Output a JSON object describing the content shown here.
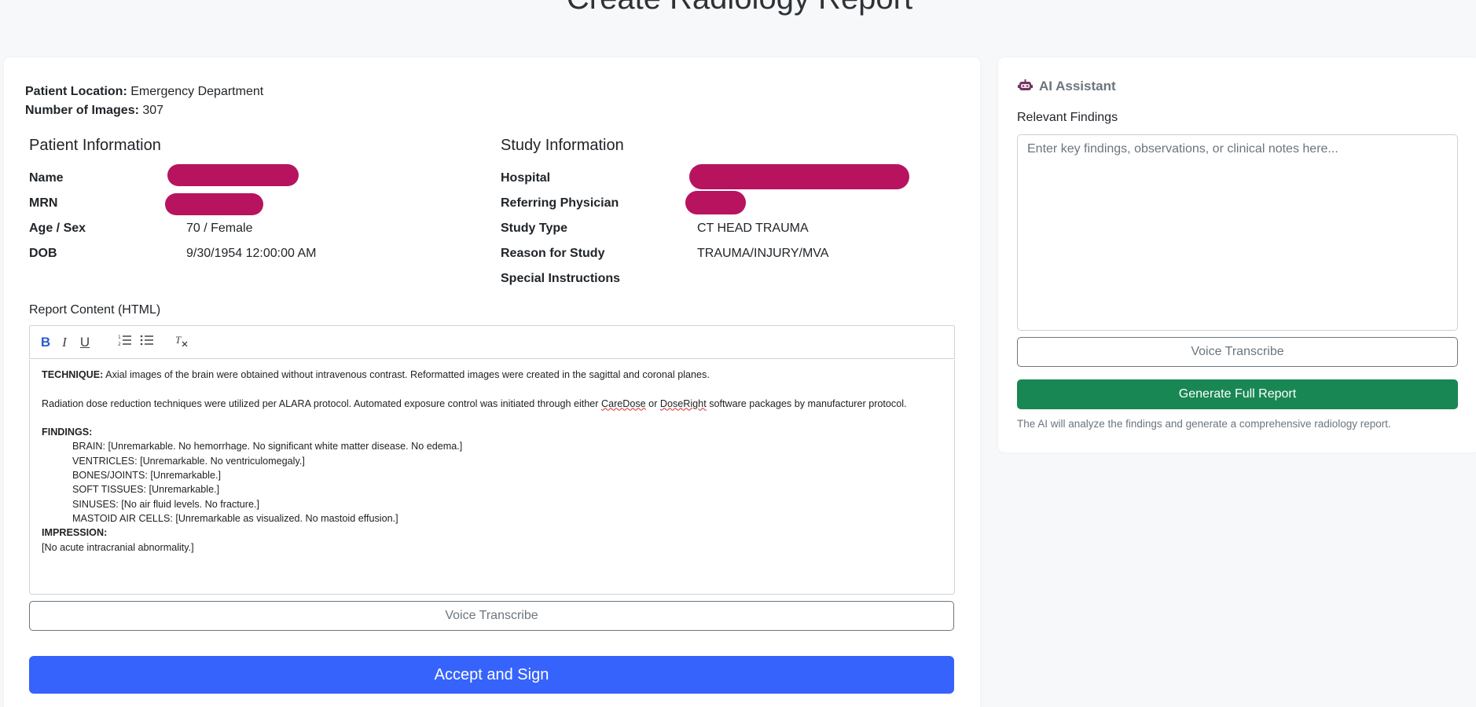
{
  "page": {
    "title": "Create Radiology Report"
  },
  "meta": {
    "location_label": "Patient Location:",
    "location_value": "Emergency Department",
    "images_label": "Number of Images:",
    "images_value": "307"
  },
  "patient": {
    "title": "Patient Information",
    "name_label": "Name",
    "mrn_label": "MRN",
    "age_sex_label": "Age / Sex",
    "age_sex_value": "70 / Female",
    "dob_label": "DOB",
    "dob_value": "9/30/1954 12:00:00 AM"
  },
  "study": {
    "title": "Study Information",
    "hospital_label": "Hospital",
    "referring_label": "Referring Physician",
    "study_type_label": "Study Type",
    "study_type_value": "CT HEAD TRAUMA",
    "reason_label": "Reason for Study",
    "reason_value": "TRAUMA/INJURY/MVA",
    "special_label": "Special Instructions"
  },
  "report": {
    "label": "Report Content (HTML)",
    "toolbar": [
      "bold",
      "italic",
      "underline",
      "ordered-list",
      "bullet-list",
      "clear-format"
    ],
    "technique_label": "TECHNIQUE:",
    "technique_text": " Axial images of the brain were obtained without intravenous contrast. Reformatted images were created in the sagittal and coronal planes.",
    "dose_text_a": "Radiation dose reduction techniques were utilized per ALARA protocol. Automated exposure control was initiated through either ",
    "dose_word_1": "CareDose",
    "dose_or": " or ",
    "dose_word_2": "DoseRight",
    "dose_text_b": " software packages by manufacturer protocol.",
    "findings_label": "FINDINGS:",
    "findings": [
      "BRAIN: [Unremarkable. No hemorrhage. No significant white matter disease. No edema.]",
      "VENTRICLES: [Unremarkable. No ventriculomegaly.]",
      "BONES/JOINTS: [Unremarkable.]",
      "SOFT TISSUES: [Unremarkable.]",
      "SINUSES: [No air fluid levels. No fracture.]",
      "MASTOID AIR CELLS: [Unremarkable as visualized. No mastoid effusion.]"
    ],
    "impression_label": "IMPRESSION:",
    "impression_text": "[No acute intracranial abnormality.]",
    "voice_button": "Voice Transcribe",
    "accept_button": "Accept and Sign"
  },
  "assistant": {
    "title": "AI Assistant",
    "icon": "robot-icon",
    "findings_label": "Relevant Findings",
    "findings_placeholder": "Enter key findings, observations, or clinical notes here...",
    "voice_button": "Voice Transcribe",
    "generate_button": "Generate Full Report",
    "help_text": "The AI will analyze the findings and generate a comprehensive radiology report."
  },
  "colors": {
    "primary": "#3563fc",
    "success": "#198754",
    "redaction": "#b8135f"
  }
}
